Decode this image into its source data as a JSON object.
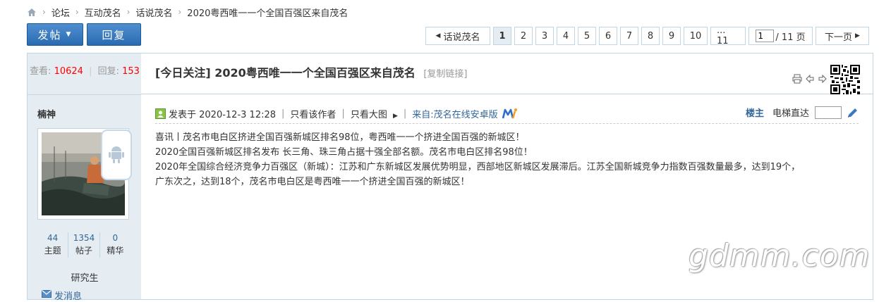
{
  "breadcrumb": {
    "items": [
      "论坛",
      "互动茂名",
      "话说茂名",
      "2020粤西唯一一个全国百强区来自茂名"
    ]
  },
  "toolbar": {
    "post_label": "发帖",
    "reply_label": "回复"
  },
  "pagination": {
    "prev_label": "话说茂名",
    "pages": [
      "1",
      "2",
      "3",
      "4",
      "5",
      "6",
      "7",
      "8",
      "9",
      "10",
      "... 11"
    ],
    "current": "1",
    "input_value": "1",
    "total_label": "/ 11 页",
    "next_label": "下一页"
  },
  "thread": {
    "views_label": "查看:",
    "views": "10624",
    "replies_label": "回复:",
    "replies": "153",
    "title": "[今日关注] 2020粤西唯一一个全国百强区来自茂名",
    "copy_link": "[复制链接]"
  },
  "author": {
    "name": "楠神",
    "topics": "44",
    "topics_label": "主题",
    "posts": "1354",
    "posts_label": "帖子",
    "digest": "0",
    "digest_label": "精华",
    "rank": "研究生",
    "send_msg": "发消息"
  },
  "post": {
    "posted_at": "发表于 2020-12-3 12:28",
    "only_author": "只看该作者",
    "only_big_img": "只看大图",
    "via": "来自:茂名在线安卓版",
    "floor": "楼主",
    "elevator": "电梯直达",
    "lines": [
      "喜讯丨茂名市电白区挤进全国百强新城区排名98位，粤西唯一一个挤进全国百强的新城区！",
      "2020全国百强新城区排名发布 长三角、珠三角占据十强全部名额。茂名市电白区排名98位！",
      "2020年全国综合经济竞争力百强区（新城）：江苏和广东新城区发展优势明显，西部地区新城区发展滞后。江苏全国新城竞争力指数百强数量最多，达到19个，",
      "广东次之，达到18个，茂名市电白区是粤西唯一一个挤进全国百强的新城区！"
    ]
  },
  "watermark": "gdmm.com",
  "colors": {
    "accent_blue": "#2a6ab0",
    "link": "#336699",
    "sidebar_bg": "#e5edf2",
    "border": "#c2d5e3",
    "stat_red": "#ff0000"
  },
  "icons": [
    "home-icon",
    "chevron-right-icon",
    "caret-down-icon",
    "print-icon",
    "arrow-left-icon",
    "arrow-right-icon",
    "qr-code-icon",
    "android-icon",
    "envelope-icon",
    "post-icon",
    "pen-icon"
  ]
}
